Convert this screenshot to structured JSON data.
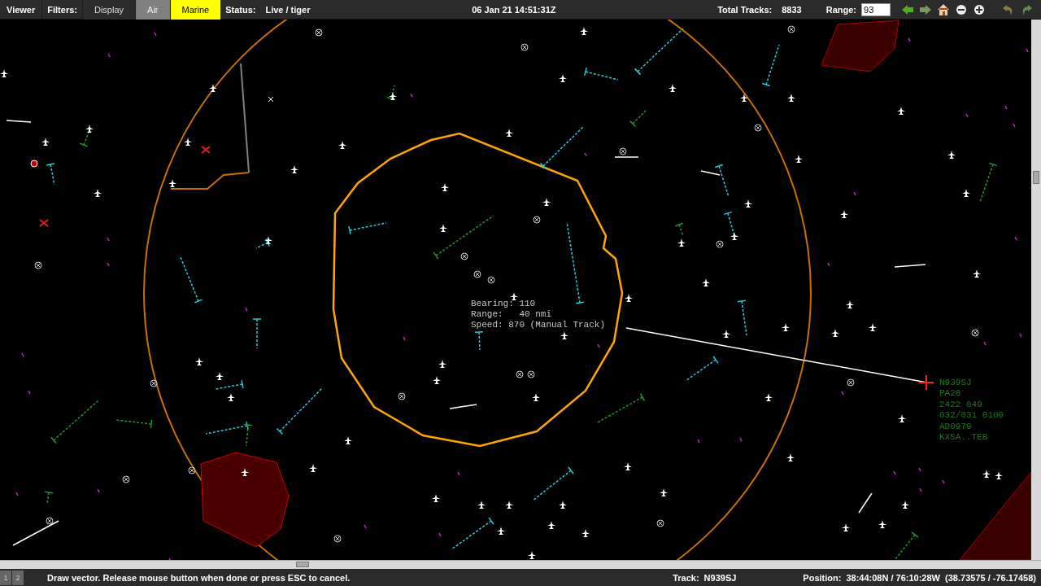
{
  "toolbar": {
    "menu": "Viewer",
    "filters_label": "Filters:",
    "filters": [
      {
        "label": "Display",
        "selected": false
      },
      {
        "label": "Air",
        "selected": true,
        "color": "#808080"
      },
      {
        "label": "Marine",
        "selected": true,
        "color": "#ffff00"
      }
    ],
    "status_label": "Status:",
    "status": "Live / tiger",
    "datetime": "06 Jan 21 14:51:31Z",
    "total_tracks_label": "Total Tracks:",
    "total_tracks": "8833",
    "range_label": "Range:",
    "range_value": "93"
  },
  "map": {
    "measure": [
      "Bearing: 110",
      "Range:   40 nmi",
      "Speed: 870 (Manual Track)"
    ],
    "track_label": [
      "N939SJ",
      "PA28",
      "2422 049",
      "032/031 0100",
      "AD0979",
      "KXSA..TEB"
    ]
  },
  "status_bar": {
    "pages": [
      "1",
      "2"
    ],
    "message": "Draw vector. Release mouse button when done or press ESC to cancel.",
    "track_label": "Track:",
    "track": "N939SJ",
    "position_label": "Position:",
    "position": "38:44:08N / 76:10:28W  (38.73575 / -76.17458)"
  }
}
